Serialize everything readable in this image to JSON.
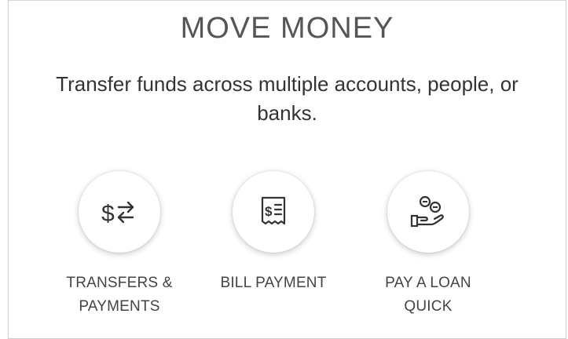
{
  "panel": {
    "title": "MOVE MONEY",
    "subtitle_line1": "Transfer funds across multiple accounts, people, or",
    "subtitle_line2": "banks."
  },
  "actions": [
    {
      "label_line1": "TRANSFERS &",
      "label_line2": "PAYMENTS",
      "icon": "dollar-transfer-icon"
    },
    {
      "label_line1": "BILL PAYMENT",
      "label_line2": "",
      "icon": "bill-receipt-icon"
    },
    {
      "label_line1": "PAY A LOAN",
      "label_line2": "QUICK",
      "icon": "hand-coins-icon"
    }
  ]
}
